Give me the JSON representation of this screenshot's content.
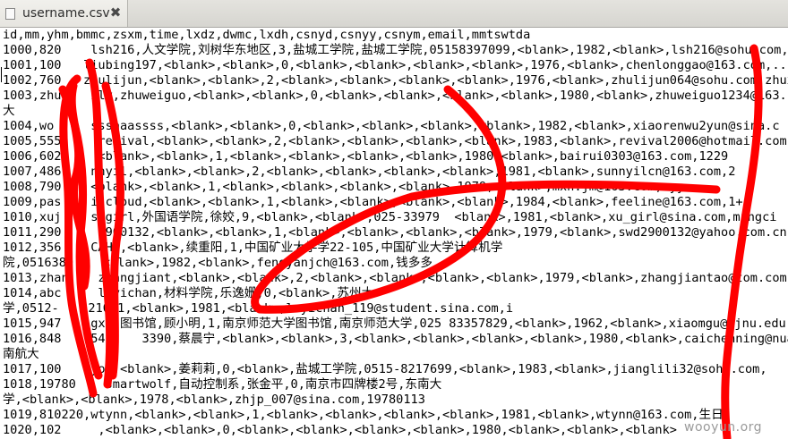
{
  "tab": {
    "title": "username.csv",
    "close_glyph": "✖",
    "file_icon": "text-file-icon",
    "close_icon": "close-icon"
  },
  "lines": [
    "id,mm,yhm,bmmc,zsxm,time,lxdz,dwmc,lxdh,csnyd,csnyy,csnym,email,mmtswtda",
    "1000,820    lsh216,人文学院,刘树华东地区,3,盐城工学院,盐城工学院,05158397099,<blank>,1982,<blank>,lsh216@sohu.com,111",
    "1001,100   liubing197,<blank>,<blank>,0,<blank>,<blank>,<blank>,<blank>,1976,<blank>,chenlonggao@163.com,...",
    "1002,760   zhulijun,<blank>,<blank>,2,<blank>,<blank>,<blank>,<blank>,1976,<blank>,zhulijun064@sohu.com,zhuxi",
    "1003,zhu    ily,zhuweiguo,<blank>,<blank>,0,<blank>,<blank>,<blank>,<blank>,1980,<blank>,zhuweiguo1234@163.n",
    "大",
    "1004,wo     sssaaassss,<blank>,<blank>,0,<blank>,<blank>,<blank>,<blank>,1982,<blank>,xiaorenwu2yun@sina.c",
    "1005,555     revival,<blank>,<blank>,2,<blank>,<blank>,<blank>,<blank>,1983,<blank>,revival2006@hotmail.com",
    "1006,602     <blank>,<blank>,1,<blank>,<blank>,<blank>,<blank>,1980,<blank>,bairui0303@163.com,1229",
    "1007,486    nnyil,<blank>,<blank>,2,<blank>,<blank>,<blank>,<blank>,1981,<blank>,sunnyilcn@163.com,2",
    "1008,790    <blank>,<blank>,1,<blank>,<blank>,<blank>,<blank>,1979,<blank>,mxh.jm@163.com,myy",
    "1009,pas    ilcloud,<blank>,<blank>,1,<blank>,<blank>,<blank>,<blank>,1984,<blank>,feeline@163.com,1+",
    "1010,xuj    shgirl,外国语学院,徐姣,9,<blank>,<blank>,025-33979  <blank>,1981,<blank>,xu_girl@sina.com,mingci",
    "1011,290     2900132,<blank>,<blank>,1,<blank>,<blank>,<blank>,<blank>,1979,<blank>,swd2900132@yahoo.com.cn,29",
    "1012,356    CAHE,<blank>,续重阳,1,中国矿业大学学22-105,中国矿业大学计算机学",
    "院,0516389    <blank>,1982,<blank>,fengyanjch@163.com,钱多多",
    "1013,zhan    zhangjiant,<blank>,<blank>,2,<blank>,<blank>,<blank>,<blank>,1979,<blank>,zhangjiantao@tom.com",
    "1014,abc     leyichan,材料学院,乐逸姗,0,<blank>,苏州大",
    "学,0512-    21031,<blank>,1981,<blank>,leyichan_119@student.sina.com,i",
    "1015,947    gxm,图书馆,顾小明,1,南京师范大学图书馆,南京师范大学,025 83357829,<blank>,1962,<blank>,xiaomgu@njnu.edu.cn,",
    "1016,848    548    3390,蔡晨宁,<blank>,<blank>,3,<blank>,<blank>,<blank>,<blank>,1980,<blank>,caichenning@nuaa.e",
    "南航大",
    "1017,100    you,<blank>,姜莉莉,0,<blank>,盐城工学院,0515-8217699,<blank>,1983,<blank>,jianglili32@sohu.com,",
    "1018,19780    smartwolf,自动控制系,张金平,0,南京市四牌楼2号,东南大",
    "学,<blank>,<blank>,1978,<blank>,zhjp_007@sina.com,19780113",
    "1019,810220,wtynn,<blank>,<blank>,1,<blank>,<blank>,<blank>,<blank>,1981,<blank>,wtynn@163.com,生日",
    "1020,102     ,<blank>,<blank>,0,<blank>,<blank>,<blank>,<blank>,1980,<blank>,<blank>,<blank>"
  ],
  "watermark": "wooyun.org",
  "colors": {
    "scribble": "#ff0000",
    "tab_bg": "#ecebe6",
    "text": "#000000",
    "watermark": "#9a9a9a"
  }
}
